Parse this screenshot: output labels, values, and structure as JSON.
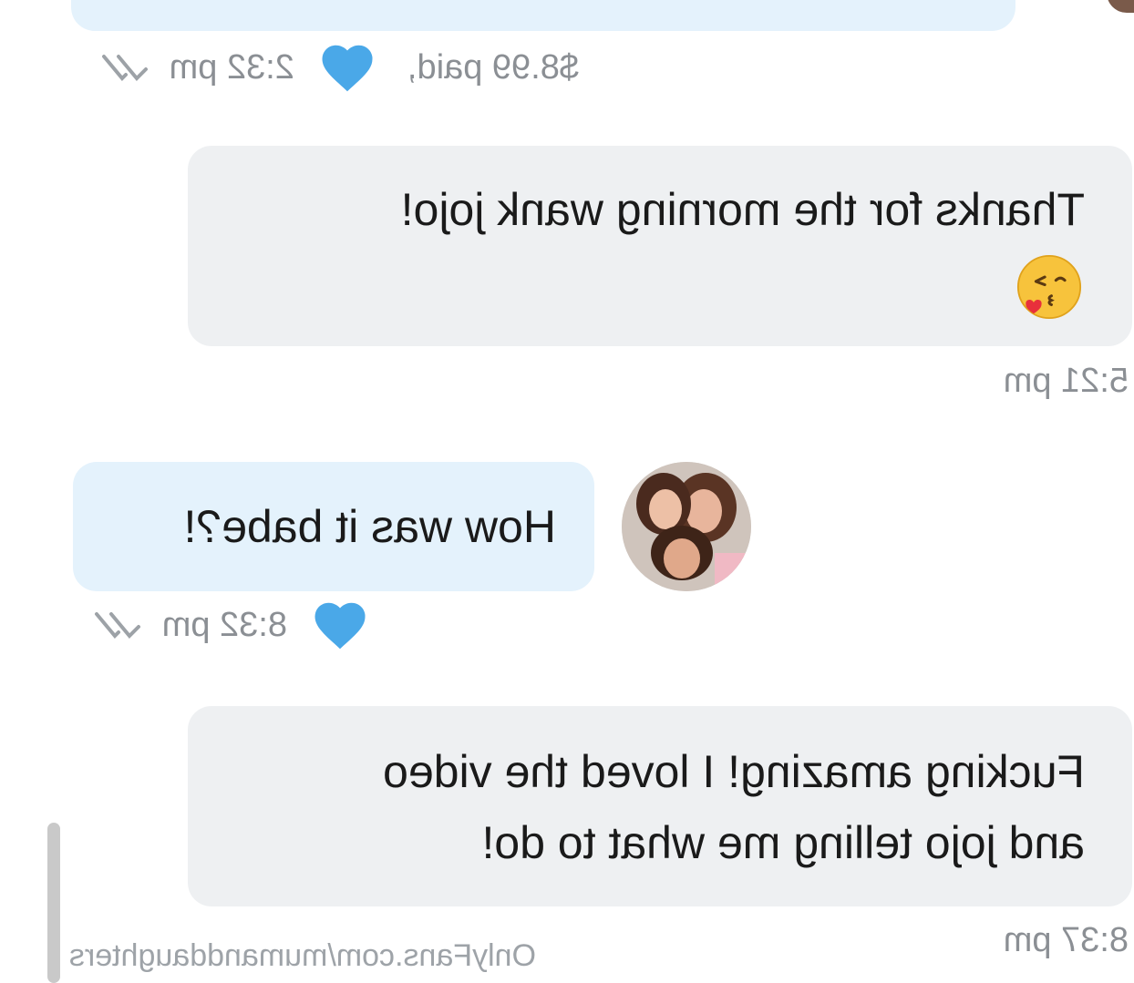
{
  "colors": {
    "bubble_outgoing": "#eef0f2",
    "bubble_incoming": "#e4f2fc",
    "heart": "#4aa8e8",
    "meta_text": "#8b8f94"
  },
  "messages": [
    {
      "id": "m1",
      "side": "incoming",
      "text": "",
      "meta": {
        "price": "$8.99 paid,",
        "time": "2:32 pm",
        "liked": true,
        "read": true
      }
    },
    {
      "id": "m2",
      "side": "outgoing",
      "text": "Thanks for the morning wank jojo!",
      "emoji": "face-blowing-a-kiss",
      "meta": {
        "time": "5:21 pm"
      }
    },
    {
      "id": "m3",
      "side": "incoming",
      "text": "How was it babe?!",
      "meta": {
        "time": "8:32 pm",
        "liked": true,
        "read": true
      }
    },
    {
      "id": "m4",
      "side": "outgoing",
      "text_line1": "Fucking amazing! I loved the video",
      "text_line2": "and jojo telling me what to do!",
      "meta": {
        "time": "8:37 pm"
      }
    }
  ],
  "watermark": "OnlyFans.com/mumanddaughters",
  "icons": [
    "heart-icon",
    "double-check-icon",
    "kiss-emoji",
    "avatar"
  ]
}
